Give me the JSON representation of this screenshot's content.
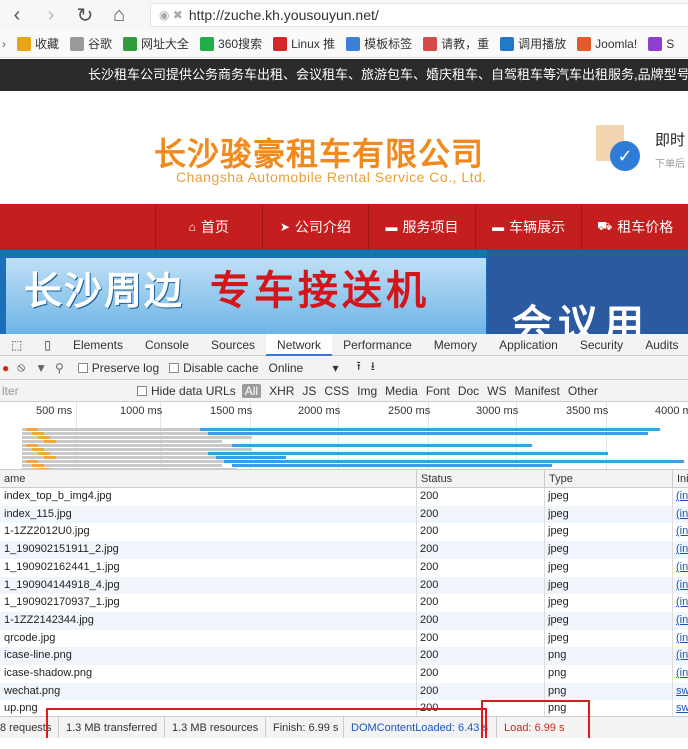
{
  "browser": {
    "url": "http://zuche.kh.yousouyun.net/",
    "bookmarks": [
      {
        "icon": "star-icon",
        "label": "收藏",
        "color": "#e8a317"
      },
      {
        "icon": "doc-icon",
        "label": "谷歌",
        "color": "#9a9a9a"
      },
      {
        "icon": "url-icon",
        "label": "网址大全",
        "color": "#2f9e3b"
      },
      {
        "icon": "360-icon",
        "label": "360搜索",
        "color": "#1fae4a"
      },
      {
        "icon": "c-icon",
        "label": "Linux 推",
        "color": "#d32626"
      },
      {
        "icon": "m-icon",
        "label": "模板标签",
        "color": "#3b7fd9"
      },
      {
        "icon": "mail-icon",
        "label": "请教，重",
        "color": "#d74a4a"
      },
      {
        "icon": "c2-icon",
        "label": "调用播放",
        "color": "#2279c9"
      },
      {
        "icon": "joomla-icon",
        "label": "Joomla!",
        "color": "#e55a2b"
      },
      {
        "icon": "s-icon",
        "label": "S",
        "color": "#8c3fd1"
      }
    ]
  },
  "site": {
    "top_strip": "长沙租车公司提供公务商务车出租、会议租车、旅游包车、婚庆租车、自驾租车等汽车出租服务,品牌型号",
    "logo_cn": "长沙骏豪租车有限公司",
    "logo_en": "Changsha Automobile Rental Service Co., Ltd.",
    "side_title": "即时",
    "side_sub": "下单后",
    "nav": [
      {
        "icon": "home-icon",
        "glyph": "⌂",
        "label": "首页"
      },
      {
        "icon": "arrow-icon",
        "glyph": "➤",
        "label": "公司介绍"
      },
      {
        "icon": "truck-icon",
        "glyph": "▬",
        "label": "服务项目"
      },
      {
        "icon": "car-icon",
        "glyph": "▬",
        "label": "车辆展示"
      },
      {
        "icon": "cart-icon",
        "glyph": "⛟",
        "label": "租车价格"
      }
    ],
    "banner_t1": "长沙周边",
    "banner_t2": "专车接送机",
    "banner_t3": "会议用"
  },
  "devtools": {
    "tabs": [
      "Elements",
      "Console",
      "Sources",
      "Network",
      "Performance",
      "Memory",
      "Application",
      "Security",
      "Audits"
    ],
    "active_tab": "Network",
    "preserve_log": "Preserve log",
    "disable_cache": "Disable cache",
    "throttle": "Online",
    "filter_placeholder": "lter",
    "hide_data_urls": "Hide data URLs",
    "filter_types": [
      "All",
      "XHR",
      "JS",
      "CSS",
      "Img",
      "Media",
      "Font",
      "Doc",
      "WS",
      "Manifest",
      "Other"
    ],
    "timeline_ticks": [
      "500 ms",
      "1000 ms",
      "1500 ms",
      "2000 ms",
      "2500 ms",
      "3000 ms",
      "3500 ms",
      "4000 m"
    ],
    "columns": {
      "name": "ame",
      "status": "Status",
      "type": "Type",
      "initiator": "Ini"
    },
    "rows": [
      {
        "name": "index_top_b_img4.jpg",
        "status": "200",
        "type": "jpeg",
        "init": "(in"
      },
      {
        "name": "index_115.jpg",
        "status": "200",
        "type": "jpeg",
        "init": "(in"
      },
      {
        "name": "1-1ZZ2012U0.jpg",
        "status": "200",
        "type": "jpeg",
        "init": "(in"
      },
      {
        "name": "1_190902151911_2.jpg",
        "status": "200",
        "type": "jpeg",
        "init": "(in"
      },
      {
        "name": "1_190902162441_1.jpg",
        "status": "200",
        "type": "jpeg",
        "init": "(in"
      },
      {
        "name": "1_190904144918_4.jpg",
        "status": "200",
        "type": "jpeg",
        "init": "(in"
      },
      {
        "name": "1_190902170937_1.jpg",
        "status": "200",
        "type": "jpeg",
        "init": "(in"
      },
      {
        "name": "1-1ZZ2142344.jpg",
        "status": "200",
        "type": "jpeg",
        "init": "(in"
      },
      {
        "name": "qrcode.jpg",
        "status": "200",
        "type": "jpeg",
        "init": "(in"
      },
      {
        "name": "icase-line.png",
        "status": "200",
        "type": "png",
        "init": "(in"
      },
      {
        "name": "icase-shadow.png",
        "status": "200",
        "type": "png",
        "init": "(in"
      },
      {
        "name": "wechat.png",
        "status": "200",
        "type": "png",
        "init": "sw"
      },
      {
        "name": "up.png",
        "status": "200",
        "type": "png",
        "init": "sw"
      }
    ],
    "status_bar": {
      "requests": "8 requests",
      "transferred": "1.3 MB transferred",
      "resources": "1.3 MB resources",
      "finish": "Finish: 6.99 s",
      "dom_loaded": "DOMContentLoaded: 6.43 s",
      "load": "Load: 6.99 s"
    }
  }
}
